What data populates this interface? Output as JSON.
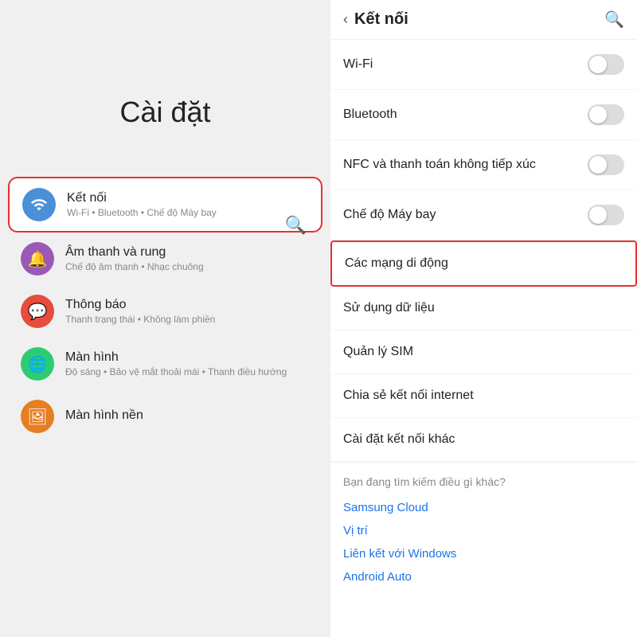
{
  "left": {
    "title": "Cài đặt",
    "items": [
      {
        "id": "ket-noi",
        "title": "Kết nối",
        "subtitle": "Wi-Fi • Bluetooth • Chế độ Máy bay",
        "icon": "wifi",
        "iconClass": "icon-blue",
        "highlighted": true
      },
      {
        "id": "am-thanh",
        "title": "Âm thanh và rung",
        "subtitle": "Chế độ âm thanh • Nhạc chuông",
        "icon": "🔔",
        "iconClass": "icon-purple",
        "highlighted": false
      },
      {
        "id": "thong-bao",
        "title": "Thông báo",
        "subtitle": "Thanh trạng thái • Không làm phiền",
        "icon": "💬",
        "iconClass": "icon-red",
        "highlighted": false
      },
      {
        "id": "man-hinh",
        "title": "Màn hình",
        "subtitle": "Độ sáng • Bảo vệ mắt thoải mái • Thanh điều hướng",
        "icon": "🌐",
        "iconClass": "icon-green",
        "highlighted": false
      },
      {
        "id": "man-hinh-nen",
        "title": "Màn hình nền",
        "subtitle": "",
        "icon": "🖼",
        "iconClass": "icon-orange",
        "highlighted": false
      }
    ]
  },
  "right": {
    "header": {
      "back_label": "‹",
      "title": "Kết nối",
      "search_icon": "🔍"
    },
    "menu_items": [
      {
        "id": "wifi",
        "label": "Wi-Fi",
        "has_toggle": true,
        "highlighted": false
      },
      {
        "id": "bluetooth",
        "label": "Bluetooth",
        "has_toggle": true,
        "highlighted": false
      },
      {
        "id": "nfc",
        "label": "NFC và thanh toán không tiếp xúc",
        "has_toggle": true,
        "highlighted": false
      },
      {
        "id": "may-bay",
        "label": "Chế độ Máy bay",
        "has_toggle": true,
        "highlighted": false
      },
      {
        "id": "mang-di-dong",
        "label": "Các mạng di động",
        "has_toggle": false,
        "highlighted": true
      },
      {
        "id": "su-dung-du-lieu",
        "label": "Sử dụng dữ liệu",
        "has_toggle": false,
        "highlighted": false
      },
      {
        "id": "quan-ly-sim",
        "label": "Quản lý SIM",
        "has_toggle": false,
        "highlighted": false
      },
      {
        "id": "chia-se",
        "label": "Chia sẻ kết nối internet",
        "has_toggle": false,
        "highlighted": false
      },
      {
        "id": "cai-dat-ket-noi",
        "label": "Cài đặt kết nối khác",
        "has_toggle": false,
        "highlighted": false
      }
    ],
    "suggestions": {
      "title": "Bạn đang tìm kiếm điều gì khác?",
      "links": [
        "Samsung Cloud",
        "Vị trí",
        "Liên kết với Windows",
        "Android Auto"
      ]
    }
  }
}
